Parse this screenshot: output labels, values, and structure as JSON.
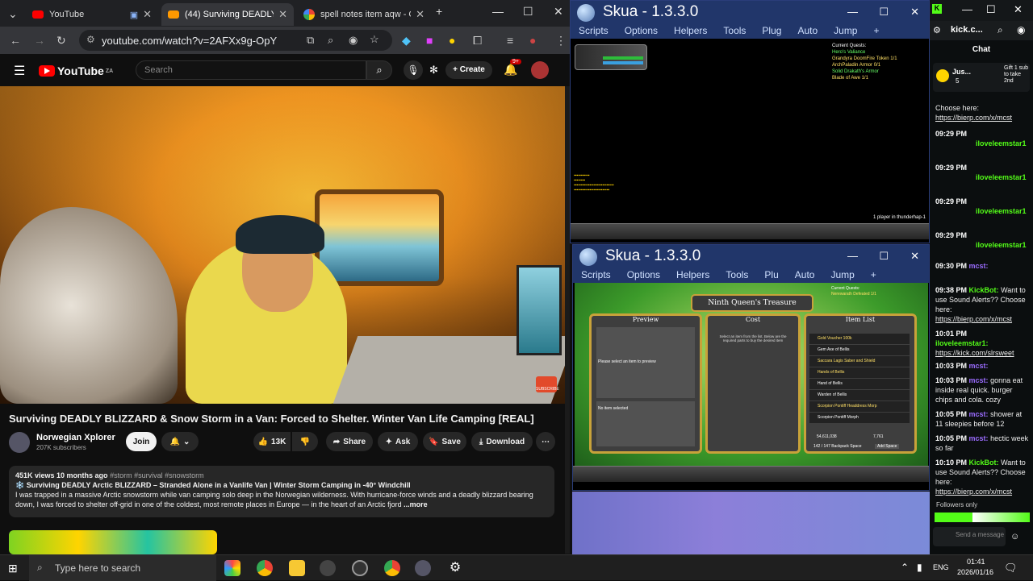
{
  "browser": {
    "tabs": [
      {
        "title": "YouTube"
      },
      {
        "title": "(44) Surviving DEADLY"
      },
      {
        "title": "spell notes item aqw - Go"
      }
    ],
    "url": "youtube.com/watch?v=2AFXx9g-OpY"
  },
  "youtube": {
    "logo": "YouTube",
    "region": "ZA",
    "search_placeholder": "Search",
    "create_label": "Create",
    "notifications_count": "9+",
    "video_title": "Surviving DEADLY BLIZZARD & Snow Storm in a Van: Forced to Shelter. Winter Van Life Camping [REAL]",
    "channel": {
      "name": "Norwegian Xplorer",
      "subscribers": "207K subscribers",
      "join_label": "Join"
    },
    "actions": {
      "likes": "13K",
      "share": "Share",
      "ask": "Ask",
      "save": "Save",
      "download": "Download"
    },
    "description": {
      "meta": "451K views  10 months ago",
      "tags": "#storm #survival #snowstorm",
      "line1": "❄️ Surviving DEADLY Arctic BLIZZARD – Stranded Alone in a Vanlife Van | Winter Storm Camping in -40° Windchill",
      "line2": "I was trapped in a massive Arctic snowstorm while van camping solo deep in the Norwegian wilderness. With hurricane-force winds and a deadly blizzard bearing",
      "line3": "down, I was forced to shelter off-grid in one of the coldest, most remote places in Europe — in the heart of an Arctic fjord",
      "more": "...more"
    },
    "subscribe_overlay": "SUBSCRIBE"
  },
  "skua_top": {
    "title": "Skua - 1.3.3.0",
    "menu": [
      "Scripts",
      "Options",
      "Helpers",
      "Tools",
      "Plug",
      "Auto",
      "Jump",
      "+"
    ],
    "quests_header": "Current Quests:",
    "quests": [
      "Hero's Valiance",
      "Grandyra DoomFire Token 1/1",
      "ArchPaladin Armor 0/1",
      "Solid Drakath's Armor",
      "Blade of Awe 1/1"
    ],
    "status": "1 player in thunderhap-1"
  },
  "skua_bottom": {
    "title": "Skua - 1.3.3.0",
    "menu": [
      "Scripts",
      "Options",
      "Helpers",
      "Tools",
      "Plu",
      "Auto",
      "Jump",
      "+"
    ],
    "shop_title": "Ninth Queen's Treasure",
    "col_preview": "Preview",
    "col_cost": "Cost",
    "col_items": "Item List",
    "preview_hint": "Please select an item to preview",
    "no_item": "No item selected",
    "cost_hint": "Select an item from the list. Below are the required parts to buy the desired item",
    "items": [
      "Gold Voucher 100k",
      "Gem Axe of Bellis",
      "Saccara Lagis Saber and Shield",
      "Hands of Bellis",
      "Hand of Bellis",
      "Warden of Bellis",
      "Scorpion Pontiff Headdress Morp",
      "Scorpion Pontiff Morph"
    ],
    "gold": "54,611,038",
    "ac": "7,761",
    "backpack": "142 / 147 Backpack Space",
    "add_space": "Add Space",
    "quests_header": "Current Quests:",
    "quest_detail": "Nerewarath Defeated 1/1"
  },
  "kick": {
    "tab": "kick.c...",
    "chat_header": "Chat",
    "gift_user": "Jus...",
    "gift_count": "5",
    "gift_text": "Gift 1 sub to take 2nd",
    "messages": [
      {
        "time": "",
        "user": "",
        "text": "Choose here:",
        "link": "https://bierp.com/x/mcst"
      },
      {
        "time": "09:29 PM",
        "user": "iloveleemstar1",
        "text": "",
        "link": ""
      },
      {
        "time": "09:29 PM",
        "user": "iloveleemstar1",
        "text": "",
        "link": ""
      },
      {
        "time": "09:29 PM",
        "user": "iloveleemstar1",
        "text": "",
        "link": ""
      },
      {
        "time": "09:29 PM",
        "user": "iloveleemstar1",
        "text": "",
        "link": ""
      },
      {
        "time": "09:30 PM",
        "user": "mcst:",
        "text": "",
        "link": ""
      },
      {
        "time": "09:38 PM",
        "user": "KickBot:",
        "text": "Want to use Sound Alerts?? Choose here:",
        "link": "https://bierp.com/x/mcst"
      },
      {
        "time": "10:01 PM",
        "user": "iloveleemstar1:",
        "text": "",
        "link": "https://kick.com/slrsweet"
      },
      {
        "time": "10:03 PM",
        "user": "mcst:",
        "text": "",
        "link": ""
      },
      {
        "time": "10:03 PM",
        "user": "mcst:",
        "text": "gonna eat inside real quick. burger chips and cola. cozy",
        "link": ""
      },
      {
        "time": "10:05 PM",
        "user": "mcst:",
        "text": "shower at 11 sleepies before 12",
        "link": ""
      },
      {
        "time": "10:05 PM",
        "user": "mcst:",
        "text": "hectic week so far",
        "link": ""
      },
      {
        "time": "10:10 PM",
        "user": "KickBot:",
        "text": "Want to use Sound Alerts?? Choose here:",
        "link": "https://bierp.com/x/mcst"
      }
    ],
    "followers_only": "Followers only",
    "send_placeholder": "Send a message"
  },
  "taskbar": {
    "search_placeholder": "Type here to search",
    "lang": "ENG",
    "time": "01:41",
    "date": "2026/01/16"
  },
  "colors": {
    "youtube_red": "#ff0000",
    "skua_blue": "#21366a",
    "kick_green": "#53fc18",
    "shop_gold": "#c8a23a"
  }
}
